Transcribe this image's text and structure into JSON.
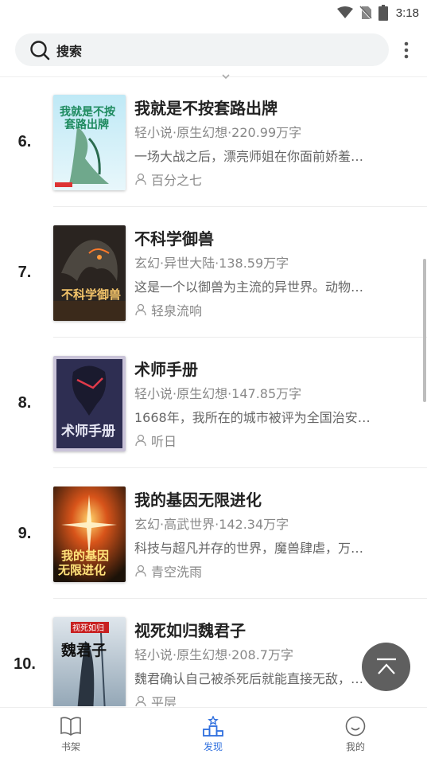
{
  "status_bar": {
    "time": "3:18"
  },
  "search": {
    "placeholder": "搜索"
  },
  "books": [
    {
      "rank": "6.",
      "title": "我就是不按套路出牌",
      "meta": "轻小说·原生幻想·220.99万字",
      "desc": " 一场大战之后，漂亮师姐在你面前娇羞…",
      "author": "百分之七",
      "cover_text": "我就是不按套路出牌"
    },
    {
      "rank": "7.",
      "title": "不科学御兽",
      "meta": "玄幻·异世大陆·138.59万字",
      "desc": "这是一个以御兽为主流的异世界。动物…",
      "author": "轻泉流响",
      "cover_text": "不科学御兽"
    },
    {
      "rank": "8.",
      "title": "术师手册",
      "meta": "轻小说·原生幻想·147.85万字",
      "desc": "1668年，我所在的城市被评为全国治安…",
      "author": "听日",
      "cover_text": "术师手册"
    },
    {
      "rank": "9.",
      "title": "我的基因无限进化",
      "meta": "玄幻·高武世界·142.34万字",
      "desc": "科技与超凡并存的世界，魔兽肆虐，万…",
      "author": "青空洗雨",
      "cover_text": "我的基因无限进化"
    },
    {
      "rank": "10.",
      "title": "视死如归魏君子",
      "meta": "轻小说·原生幻想·208.7万字",
      "desc": "魏君确认自己被杀死后就能直接无敌，…",
      "author": "平层",
      "cover_text": "视死如归魏君子"
    }
  ],
  "nav": {
    "bookshelf": "书架",
    "discover": "发现",
    "mine": "我的"
  },
  "colors": {
    "accent": "#2f6fde",
    "fab": "#5f5f5f"
  }
}
